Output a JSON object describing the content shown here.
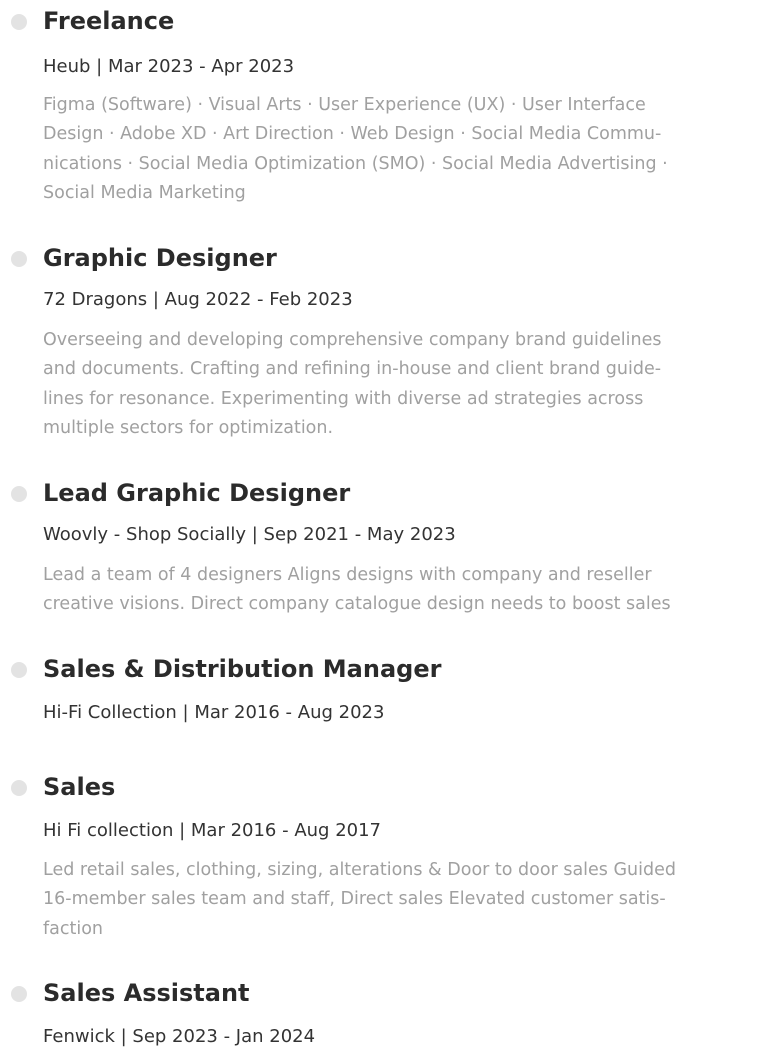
{
  "entries": [
    {
      "title": "Freelance",
      "meta": "Heub | Mar 2023 - Apr 2023",
      "desc_lines": [
        "Figma (Software) · Visual Arts · User Experience (UX) · User Interface",
        "Design · Adobe XD · Art Direction · Web Design · Social Media Commu-",
        "nications · Social Media Optimization (SMO) · Social Media Advertising ·",
        "Social Media Marketing"
      ]
    },
    {
      "title": "Graphic Designer",
      "meta": "72 Dragons | Aug 2022 - Feb 2023",
      "desc_lines": [
        "Overseeing and developing comprehensive company brand guidelines",
        "and documents. Crafting and refining in-house and client brand guide-",
        "lines for resonance. Experimenting with diverse ad strategies across",
        "multiple sectors for optimization."
      ]
    },
    {
      "title": "Lead Graphic Designer",
      "meta": "Woovly - Shop Socially | Sep 2021 - May 2023",
      "desc_lines": [
        "Lead a team of 4 designers Aligns designs with company and reseller",
        "creative visions. Direct company catalogue design needs to boost sales"
      ]
    },
    {
      "title": "Sales & Distribution Manager",
      "meta": "Hi-Fi Collection | Mar 2016 - Aug 2023",
      "desc_lines": []
    },
    {
      "title": "Sales",
      "meta": "Hi Fi collection | Mar 2016 - Aug 2017",
      "desc_lines": [
        "Led retail sales, clothing, sizing, alterations & Door to door sales Guided",
        "16-member sales team and staff, Direct sales Elevated customer satis-",
        "faction"
      ]
    },
    {
      "title": "Sales Assistant",
      "meta": "Fenwick | Sep 2023 - Jan 2024",
      "desc_lines": []
    }
  ]
}
